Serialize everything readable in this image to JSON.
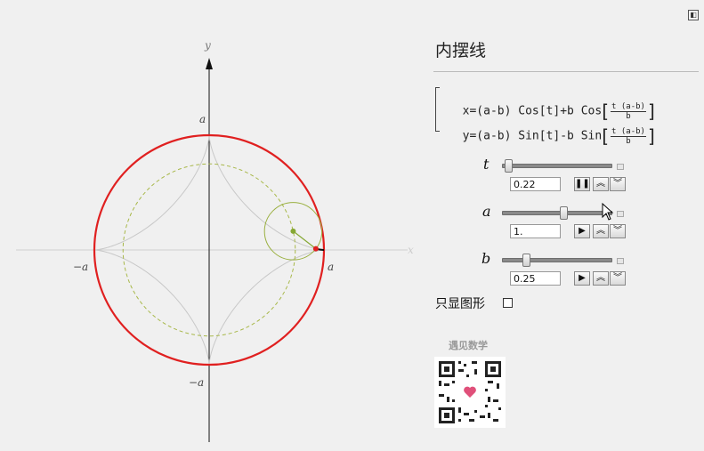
{
  "panel": {
    "title": "内摆线",
    "collapse_icon": "collapse-icon",
    "equations": {
      "x_prefix": "x=(a-b) Cos[t]+b Cos",
      "y_prefix": "y=(a-b) Sin[t]-b Sin",
      "frac_num": "t (a-b)",
      "frac_den": "b"
    },
    "controls": {
      "t": {
        "label": "t",
        "value": "0.22",
        "slider_fraction": 0.03,
        "buttons": [
          "pause-icon",
          "faster-icon",
          "slower-icon"
        ]
      },
      "a": {
        "label": "a",
        "value": "1.",
        "slider_fraction": 0.57,
        "buttons": [
          "play-icon",
          "faster-icon",
          "slower-icon"
        ]
      },
      "b": {
        "label": "b",
        "value": "0.25",
        "slider_fraction": 0.2,
        "buttons": [
          "play-icon",
          "faster-icon",
          "slower-icon"
        ]
      }
    },
    "checkbox_label": "只显图形",
    "checkbox_checked": false,
    "qr_title": "遇见数学"
  },
  "plot": {
    "x_axis_label": "x",
    "y_axis_label": "y",
    "tick_pos_x": "a",
    "tick_neg_x": "−a",
    "tick_pos_y": "a",
    "tick_neg_y": "−a",
    "a": 1.0,
    "b": 0.25,
    "t": 0.22,
    "colors": {
      "outer_circle": "#e02020",
      "inner_dashed": "#a8b84a",
      "astroid": "#c8c8c8",
      "rolling_circle": "#9ab040",
      "traced_curve": "#111111",
      "trace_point": "#e02020",
      "center_point": "#86a834"
    }
  }
}
